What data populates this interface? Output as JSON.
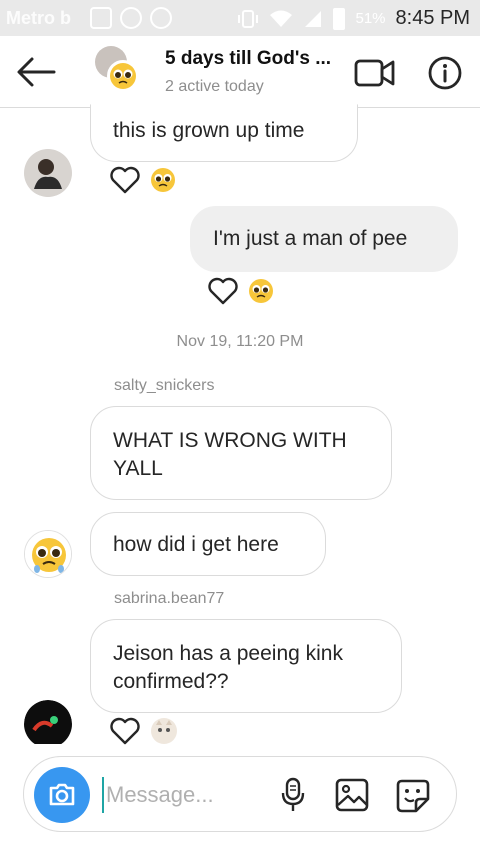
{
  "status_bar": {
    "carrier": "Metro b",
    "battery_pct": "51%",
    "time": "8:45 PM"
  },
  "header": {
    "title": "5 days till God's ...",
    "subtitle": "2 active today",
    "icons": [
      "back-arrow-icon",
      "video-call-icon",
      "info-icon"
    ]
  },
  "messages": [
    {
      "text": "this is grown up time",
      "mine": false
    },
    {
      "text": "I'm just a man of pee",
      "mine": true
    },
    {
      "text": "WHAT IS WRONG WITH YALL",
      "mine": false,
      "sender": "salty_snickers"
    },
    {
      "text": "how did i get here",
      "mine": false
    },
    {
      "text": "Jeison has a peeing kink confirmed??",
      "mine": false,
      "sender": "sabrina.bean77"
    }
  ],
  "timestamp": "Nov 19, 11:20 PM",
  "senders": {
    "first": "salty_snickers",
    "second": "sabrina.bean77"
  },
  "composer": {
    "placeholder": "Message..."
  },
  "colors": {
    "accent": "#3897f0",
    "bubble_border": "#dbdbdb",
    "mine_bubble": "#efefef",
    "meta_text": "#8e8e8e"
  }
}
